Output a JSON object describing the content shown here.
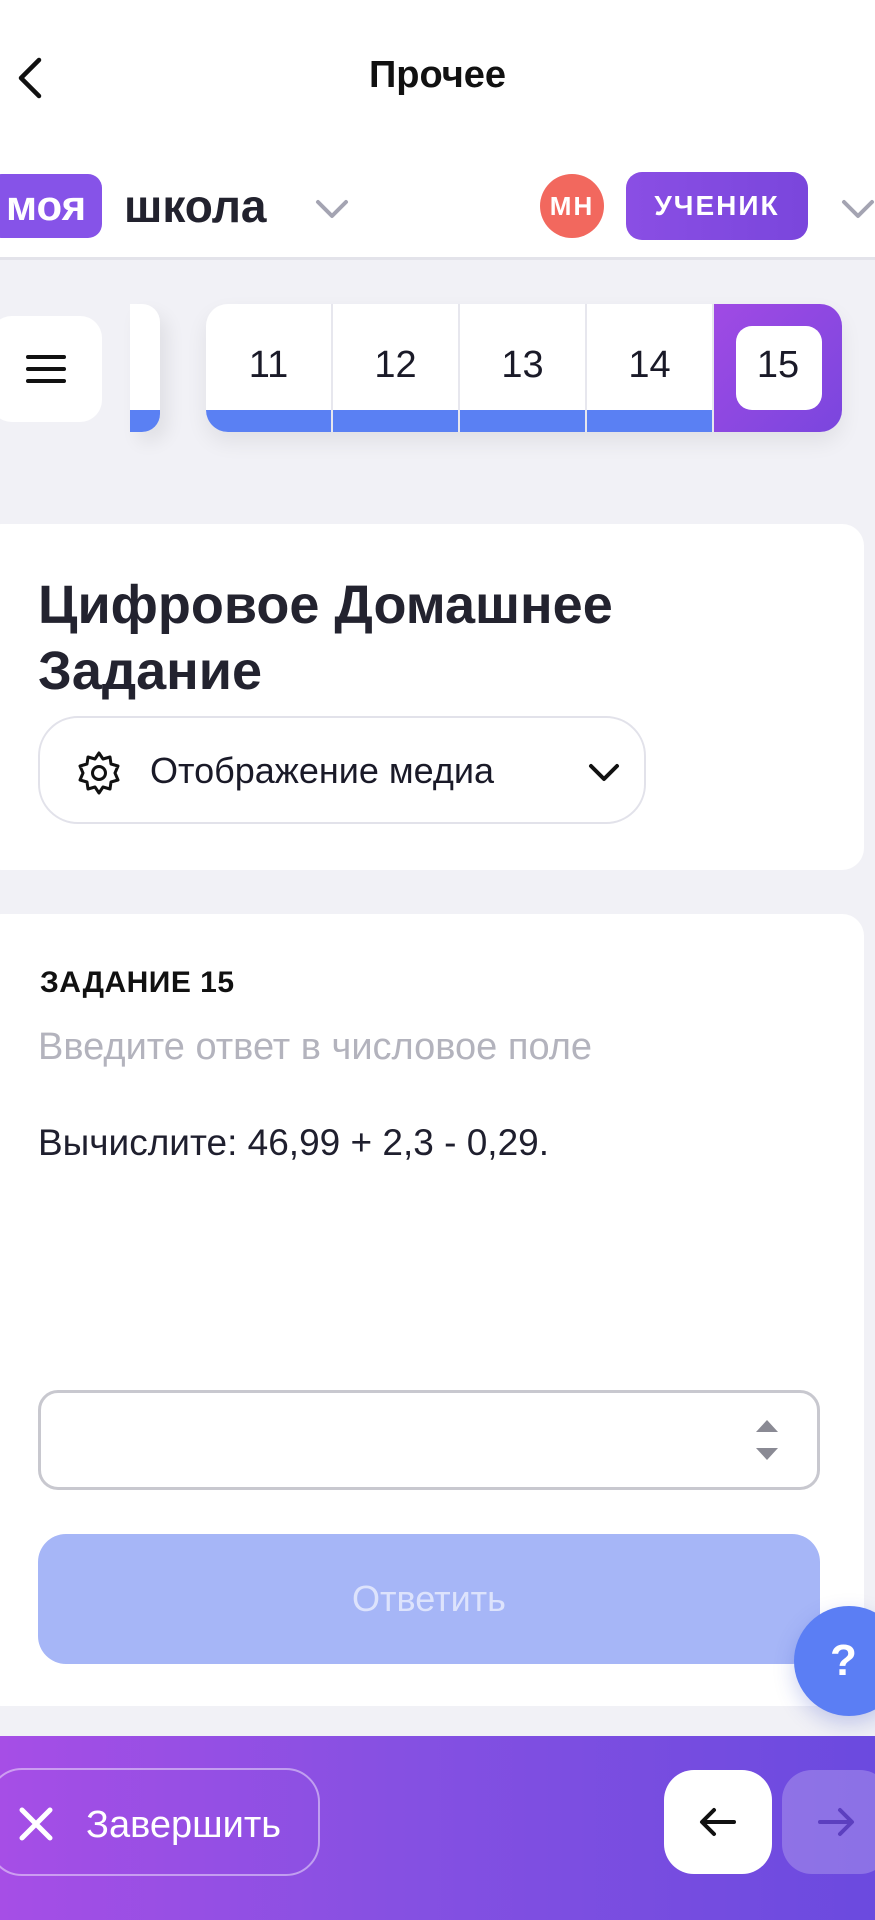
{
  "nav": {
    "title": "Прочее",
    "back_icon": "chevron-left-icon"
  },
  "brand": {
    "part1": "моя",
    "part2": "школа",
    "accent_color": "#8653e8"
  },
  "user": {
    "initials": "МН",
    "role": "УЧЕНИК",
    "avatar_color": "#f2685e"
  },
  "task_nav": {
    "menu_icon": "hamburger-icon",
    "tasks": [
      {
        "number": "11",
        "done": true
      },
      {
        "number": "12",
        "done": true
      },
      {
        "number": "13",
        "done": true
      },
      {
        "number": "14",
        "done": true
      },
      {
        "number": "15",
        "done": false,
        "active": true
      }
    ],
    "done_color": "#5a80f3"
  },
  "header_card": {
    "title": "Цифровое Домашнее Задание",
    "media_button_label": "Отображение медиа",
    "media_icon": "gear-icon"
  },
  "task": {
    "heading": "ЗАДАНИЕ 15",
    "hint": "Введите ответ в числовое поле",
    "question": "Вычислите: 46,99 + 2,3 - 0,29.",
    "answer_value": "",
    "submit_label": "Ответить"
  },
  "help": {
    "label": "?"
  },
  "bottom": {
    "finish_label": "Завершить",
    "prev_icon": "arrow-left-icon",
    "next_icon": "arrow-right-icon"
  }
}
